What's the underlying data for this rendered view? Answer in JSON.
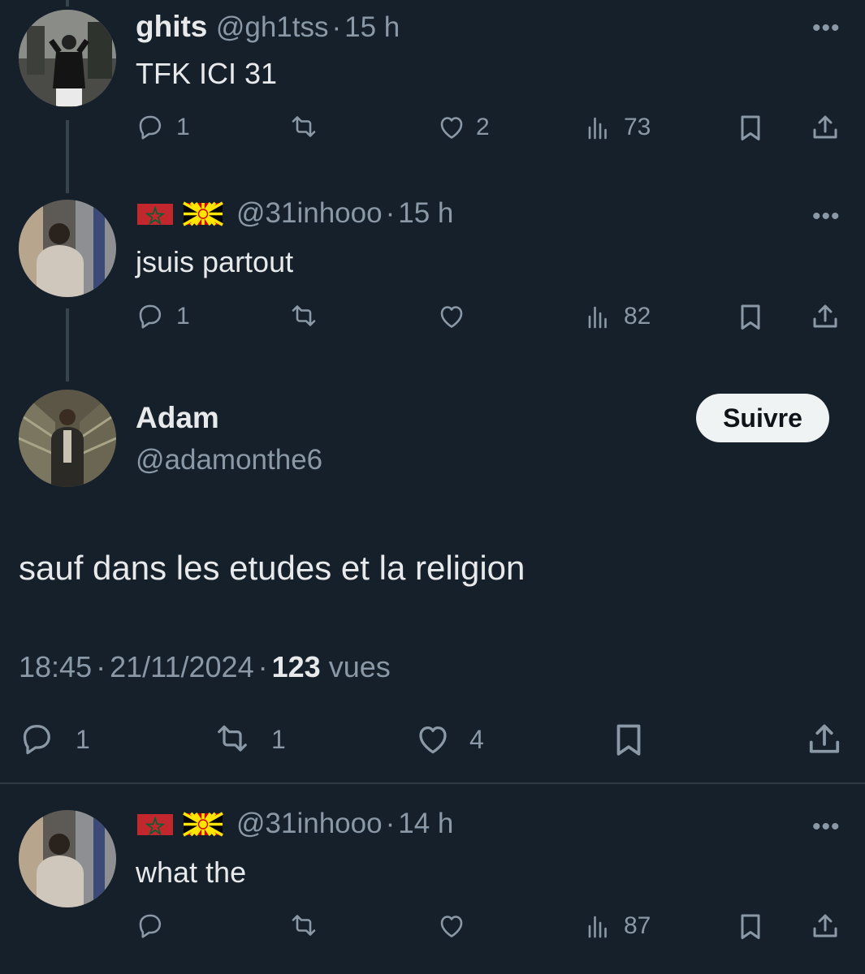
{
  "tweets": [
    {
      "name": "ghits",
      "handle": "@gh1tss",
      "time": "15 h",
      "text": "TFK ICI 31",
      "replies": "1",
      "retweets": "",
      "likes": "2",
      "views": "73"
    },
    {
      "name": "",
      "handle": "@31inhooo",
      "time": "15 h",
      "text": "jsuis partout",
      "replies": "1",
      "retweets": "",
      "likes": "",
      "views": "82"
    }
  ],
  "main": {
    "name": "Adam",
    "handle": "@adamonthe6",
    "follow_label": "Suivre",
    "text": "sauf dans les etudes et la religion",
    "time": "18:45",
    "date": "21/11/2024",
    "views_count": "123",
    "views_label": "vues",
    "replies": "1",
    "retweets": "1",
    "likes": "4"
  },
  "reply": {
    "handle": "@31inhooo",
    "time": "14 h",
    "text": "what the",
    "replies": "",
    "retweets": "",
    "likes": "",
    "views": "87"
  },
  "separator": "·",
  "more_label": "•••",
  "icons": [
    "reply-icon",
    "retweet-icon",
    "like-icon",
    "views-icon",
    "bookmark-icon",
    "share-icon",
    "more-icon"
  ],
  "colors": {
    "background": "#15202b",
    "text": "#e7e9ea",
    "muted": "#8b98a5",
    "flag_morocco": "#c1272d",
    "flag_macedonia": "#d20000"
  }
}
